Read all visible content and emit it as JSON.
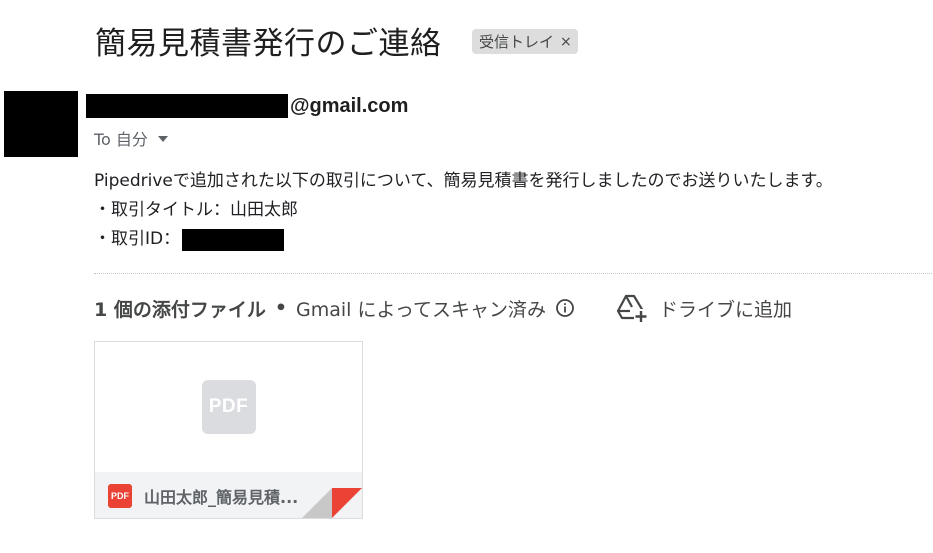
{
  "email": {
    "subject": "簡易見積書発行のご連絡",
    "label": {
      "text": "受信トレイ",
      "close": "×"
    },
    "sender": {
      "domain": "@gmail.com"
    },
    "recipient": {
      "text": "To 自分"
    },
    "body": {
      "line1": "Pipedriveで追加された以下の取引について、簡易見積書を発行しましたのでお送りいたします。",
      "line2": "・取引タイトル：山田太郎",
      "line3_prefix": "・取引ID："
    }
  },
  "attachments": {
    "count_label": "1 個の添付ファイル",
    "separator": "•",
    "scan_text": "Gmail によってスキャン済み",
    "drive_button": "ドライブに追加",
    "items": [
      {
        "preview_badge": "PDF",
        "type_badge": "PDF",
        "name": "山田太郎_簡易見積..."
      }
    ]
  },
  "colors": {
    "pdf_red": "#ea4335",
    "chip_bg": "#dddddd",
    "text_primary": "#202124",
    "text_secondary": "#5f6368"
  }
}
